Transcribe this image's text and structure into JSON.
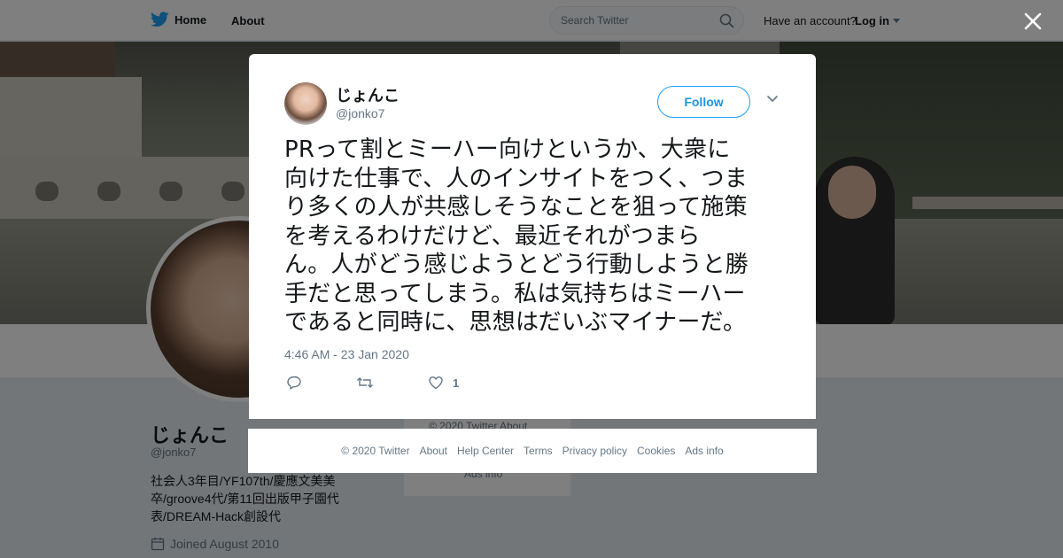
{
  "nav": {
    "home_label": "Home",
    "about_label": "About",
    "search_placeholder": "Search Twitter",
    "account_prompt": "Have an account?",
    "login_label": "Log in"
  },
  "profile": {
    "name": "じょんこ",
    "handle": "@jonko7",
    "bio": "社会人3年目/YF107th/慶應文美美卒/groove4代/第11回出版甲子園代表/DREAM-Hack創設代",
    "joined": "Joined August 2010"
  },
  "background_footer": {
    "copyright": "© 2020 Twitter",
    "about": "About",
    "ads_info": "Ads info"
  },
  "tweet": {
    "author_name": "じょんこ",
    "author_handle": "@jonko7",
    "follow_label": "Follow",
    "text_lines": [
      "PRって割とミーハー向けというか、大衆に",
      "向けた仕事で、人のインサイトをつく、つま",
      "り多くの人が共感しそうなことを狙って施策",
      "を考えるわけだけど、最近それがつまら",
      "ん。人がどう感じようとどう行動しようと勝",
      "手だと思ってしまう。私は気持ちはミーハー",
      "であると同時に、思想はだいぶマイナーだ。"
    ],
    "timestamp": "4:46 AM - 23 Jan 2020",
    "like_count": "1"
  },
  "footer": {
    "links": [
      "© 2020 Twitter",
      "About",
      "Help Center",
      "Terms",
      "Privacy policy",
      "Cookies",
      "Ads info"
    ]
  },
  "colors": {
    "accent": "#1da1f2",
    "text_secondary": "#657786"
  },
  "icons": {
    "logo": "twitter-bird-icon",
    "search": "search-icon",
    "close": "close-icon",
    "reply": "reply-icon",
    "retweet": "retweet-icon",
    "like": "heart-icon",
    "more": "chevron-down-icon",
    "calendar": "calendar-icon"
  }
}
